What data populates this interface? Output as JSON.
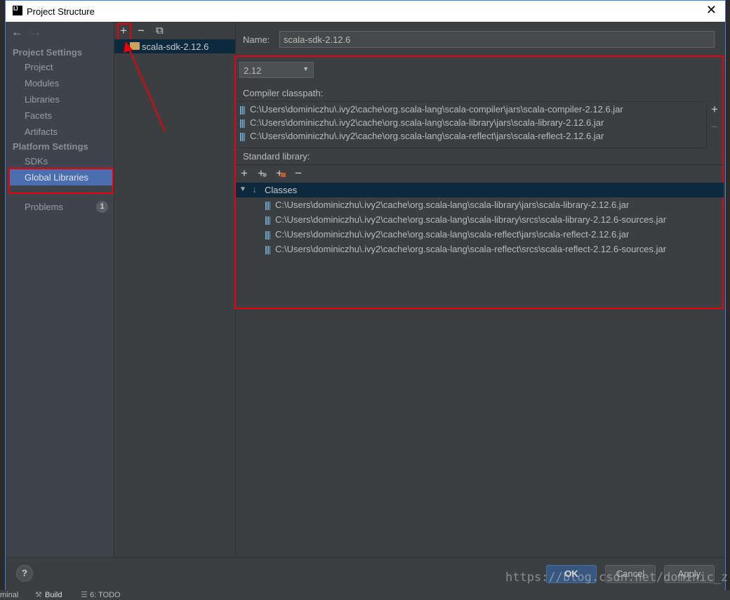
{
  "window": {
    "title": "Project Structure",
    "logo": "IJ",
    "close": "✕"
  },
  "sidebar": {
    "back": "←",
    "forward": "→",
    "project_settings": "Project Settings",
    "items_project": [
      "Project",
      "Modules",
      "Libraries",
      "Facets",
      "Artifacts"
    ],
    "platform_settings": "Platform Settings",
    "items_platform": [
      "SDKs",
      "Global Libraries"
    ],
    "selected": "Global Libraries",
    "problems": "Problems",
    "problems_count": "1"
  },
  "middle": {
    "toolbar": {
      "add": "+",
      "remove": "−",
      "copy": "⧉"
    },
    "library": "scala-sdk-2.12.6"
  },
  "detail": {
    "name_label": "Name:",
    "name_value": "scala-sdk-2.12.6",
    "version": "2.12",
    "compiler_classpath_label": "Compiler classpath:",
    "compiler_classpath": [
      "C:\\Users\\dominiczhu\\.ivy2\\cache\\org.scala-lang\\scala-compiler\\jars\\scala-compiler-2.12.6.jar",
      "C:\\Users\\dominiczhu\\.ivy2\\cache\\org.scala-lang\\scala-library\\jars\\scala-library-2.12.6.jar",
      "C:\\Users\\dominiczhu\\.ivy2\\cache\\org.scala-lang\\scala-reflect\\jars\\scala-reflect-2.12.6.jar"
    ],
    "classpath_add": "+",
    "classpath_remove": "−",
    "standard_library_label": "Standard library:",
    "classes_label": "Classes",
    "classes": [
      "C:\\Users\\dominiczhu\\.ivy2\\cache\\org.scala-lang\\scala-library\\jars\\scala-library-2.12.6.jar",
      "C:\\Users\\dominiczhu\\.ivy2\\cache\\org.scala-lang\\scala-library\\srcs\\scala-library-2.12.6-sources.jar",
      "C:\\Users\\dominiczhu\\.ivy2\\cache\\org.scala-lang\\scala-reflect\\jars\\scala-reflect-2.12.6.jar",
      "C:\\Users\\dominiczhu\\.ivy2\\cache\\org.scala-lang\\scala-reflect\\srcs\\scala-reflect-2.12.6-sources.jar"
    ]
  },
  "footer": {
    "help": "?",
    "ok": "OK",
    "cancel": "Cancel",
    "apply": "Apply",
    "watermark": "https://blog.csdn.net/dominic_z"
  },
  "taskbar": {
    "items": [
      "minal",
      "Build",
      "6: TODO"
    ]
  },
  "colors": {
    "annotation": "#e8000b",
    "selection": "#4b6eaf",
    "tree_selection": "#0d293e"
  }
}
